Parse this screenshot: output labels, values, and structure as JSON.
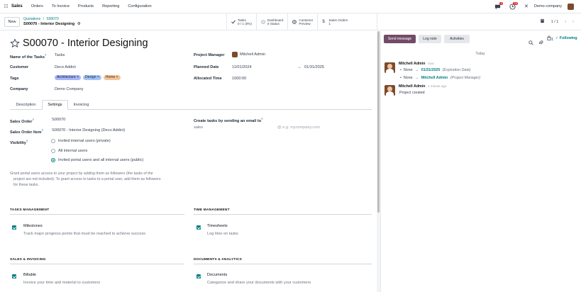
{
  "topnav": {
    "app_name": "Sales",
    "menus": [
      "Orders",
      "To Invoice",
      "Products",
      "Reporting",
      "Configuration"
    ],
    "chat_badge": "5",
    "activity_badge": "18",
    "company": "Demo company"
  },
  "control": {
    "new_label": "New",
    "breadcrumb_parent": "Quotations",
    "breadcrumb_sep": "/",
    "breadcrumb_order": "S00070",
    "breadcrumb_current": "S00070 - Interior Designing",
    "smart": {
      "tasks_label": "Tasks",
      "tasks_value": "0 / 1 (0%)",
      "dashboard_label": "Dashboard",
      "dashboard_value": "0 Status",
      "customer_label": "Customer",
      "customer_value": "Preview",
      "sales_label": "Sales Orders",
      "sales_value": "1"
    },
    "pager": "1 / 1"
  },
  "form": {
    "title": "S00070 - Interior Designing",
    "fields": {
      "name_tasks_label": "Name of the Tasks",
      "name_tasks_value": "Tasks",
      "customer_label": "Customer",
      "customer_value": "Deco Addict",
      "tags_label": "Tags",
      "tags": [
        {
          "name": "Architecture",
          "color": "#a7b6f5"
        },
        {
          "name": "Design",
          "color": "#a6c4f3"
        },
        {
          "name": "Home",
          "color": "#f3c49a"
        }
      ],
      "company_label": "Company",
      "company_value": "Demo Company",
      "pm_label": "Project Manager",
      "pm_value": "Mitchell Admin",
      "planned_label": "Planned Date",
      "planned_start": "11/01/2024",
      "planned_arrow": "→",
      "planned_end": "01/31/2025",
      "alloc_label": "Allocated Time",
      "alloc_value": "1000:00"
    },
    "tabs": [
      "Description",
      "Settings",
      "Invoicing"
    ],
    "active_tab": "Settings",
    "settings": {
      "so_label": "Sales Order",
      "so_value": "S00070",
      "soi_label": "Sales Order Item",
      "soi_value": "S00070 - Interior Designing (Deco Addict)",
      "visibility_label": "Visibility",
      "vis_options": [
        "Invited internal users (private)",
        "All internal users",
        "Invited portal users and all internal users (public)"
      ],
      "email_label": "Create tasks by sending an email to",
      "email_alias": "sales",
      "email_domain": "e.g. mycompany.com",
      "note_line1": "Grant portal users access to your project by adding them as followers (the tasks of the",
      "note_line2": "project are not included). To grant access to tasks to a portal user, add them as followers",
      "note_line3": "for these tasks.",
      "sections": {
        "tasks_mgmt": "TASKS MANAGEMENT",
        "time_mgmt": "TIME MANAGEMENT",
        "sales_inv": "SALES & INVOICING",
        "docs": "DOCUMENTS & ANALYTICS"
      },
      "features": {
        "milestones_title": "Milestones",
        "milestones_desc": "Track major progress points that must be reached to achieve success",
        "timesheets_title": "Timesheets",
        "timesheets_desc": "Log time on tasks",
        "billable_title": "Billable",
        "billable_desc": "Invoice your time and material to customers",
        "documents_title": "Documents",
        "documents_desc": "Categorize and share your documents with your customers"
      }
    }
  },
  "chatter": {
    "send_message": "Send message",
    "log_note": "Log note",
    "activities": "Activities",
    "following": "Following",
    "follower_count": "1",
    "date_sep": "Today",
    "messages": [
      {
        "author": "Mitchell Admin",
        "time": "now",
        "changes": [
          {
            "old": "None",
            "arrow": "→",
            "new": "01/31/2025",
            "field": "(Expiration Date)"
          },
          {
            "old": "None",
            "arrow": "→",
            "new": "Mitchell Admin",
            "field": "(Project Manager)"
          }
        ]
      },
      {
        "author": "Mitchell Admin",
        "time": "1 minute ago",
        "body": "Project created"
      }
    ]
  },
  "colors": {
    "accent": "#017e84",
    "primary": "#714b67",
    "link": "#017e84"
  }
}
